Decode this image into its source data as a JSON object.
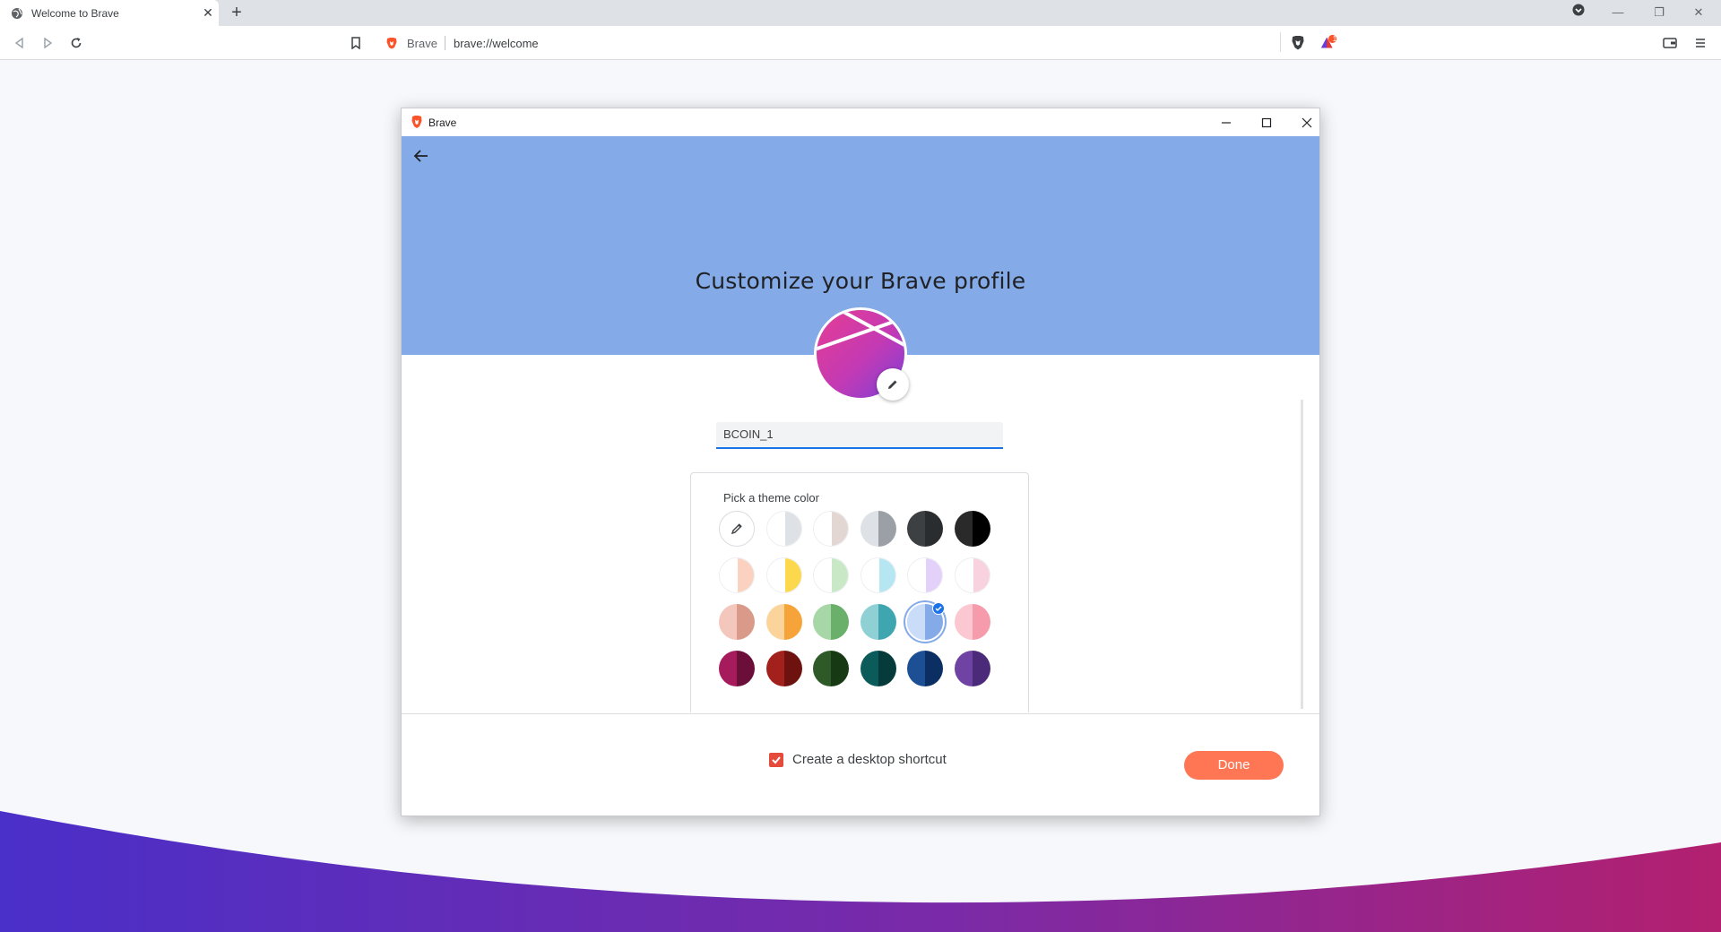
{
  "browser": {
    "tab_title": "Welcome to Brave",
    "omnibox_site": "Brave",
    "omnibox_url": "brave://welcome",
    "rewards_badge": "1"
  },
  "dialog": {
    "window_title": "Brave",
    "heading": "Customize your Brave profile",
    "profile_name": "BCOIN_1",
    "theme_label": "Pick a theme color",
    "shortcut_label": "Create a desktop shortcut",
    "shortcut_checked": true,
    "done_label": "Done",
    "banner_color": "#84abe8",
    "accent_color": "#ff7654"
  },
  "theme_colors": [
    [
      {
        "type": "picker",
        "icon": "eyedropper-icon"
      },
      {
        "left": "#ffffff",
        "right": "#dee1e6"
      },
      {
        "left": "#ffffff",
        "right": "#e3d7d4"
      },
      {
        "left": "#dee1e6",
        "right": "#9aa0a6"
      },
      {
        "left": "#3c4043",
        "right": "#2a2d30"
      },
      {
        "left": "#2a2a2a",
        "right": "#000000"
      }
    ],
    [
      {
        "left": "#ffffff",
        "right": "#fad2bf"
      },
      {
        "left": "#ffffff",
        "right": "#fcd94c"
      },
      {
        "left": "#ffffff",
        "right": "#c9e9c6"
      },
      {
        "left": "#ffffff",
        "right": "#b6e6f2"
      },
      {
        "left": "#ffffff",
        "right": "#e4d1fa"
      },
      {
        "left": "#ffffff",
        "right": "#f8d2df"
      }
    ],
    [
      {
        "left": "#f3c7bb",
        "right": "#d99a8a"
      },
      {
        "left": "#fbd49c",
        "right": "#f6a43a"
      },
      {
        "left": "#a8d7a7",
        "right": "#6aaf6a"
      },
      {
        "left": "#8ed0d4",
        "right": "#3fa6b0"
      },
      {
        "left": "#c9dcf8",
        "right": "#84abe8",
        "selected": true
      },
      {
        "left": "#fbc7d1",
        "right": "#f69bac"
      }
    ],
    [
      {
        "left": "#a51b5c",
        "right": "#6b0f3a"
      },
      {
        "left": "#a3211c",
        "right": "#6e120f"
      },
      {
        "left": "#2d5a27",
        "right": "#173a14"
      },
      {
        "left": "#0c5b5b",
        "right": "#063b3c"
      },
      {
        "left": "#1d4f95",
        "right": "#0b2f63"
      },
      {
        "left": "#6e43a3",
        "right": "#4b2a79"
      }
    ]
  ]
}
